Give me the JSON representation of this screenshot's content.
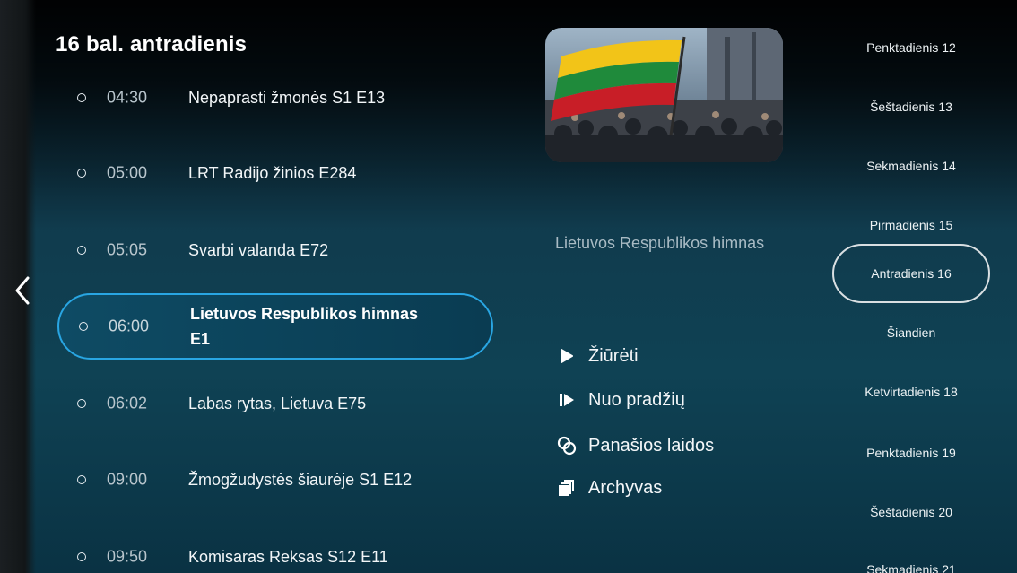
{
  "header": {
    "title": "16 bal. antradienis"
  },
  "programs": [
    {
      "time": "04:30",
      "title": "Nepaprasti žmonės S1 E13"
    },
    {
      "time": "05:00",
      "title": "LRT Radijo žinios E284"
    },
    {
      "time": "05:05",
      "title": "Svarbi valanda E72"
    },
    {
      "time": "06:00",
      "title": "Lietuvos Respublikos himnas E1",
      "selected": true
    },
    {
      "time": "06:02",
      "title": "Labas rytas, Lietuva E75"
    },
    {
      "time": "09:00",
      "title": "Žmogžudystės šiaurėje S1 E12"
    },
    {
      "time": "09:50",
      "title": "Komisaras Reksas S12 E11"
    }
  ],
  "details": {
    "description": "Lietuvos Respublikos himnas",
    "actions": [
      {
        "label": "Žiūrėti",
        "icon": "play-icon"
      },
      {
        "label": "Nuo pradžių",
        "icon": "restart-icon"
      },
      {
        "label": "Panašios laidos",
        "icon": "similar-icon"
      },
      {
        "label": "Archyvas",
        "icon": "archive-icon"
      }
    ]
  },
  "days": [
    "Penktadienis 12",
    "Šeštadienis 13",
    "Sekmadienis 14",
    "Pirmadienis 15",
    "Antradienis 16",
    "Šiandien",
    "Ketvirtadienis 18",
    "Penktadienis 19",
    "Šeštadienis 20",
    "Sekmadienis 21"
  ],
  "active_day_index": 4,
  "colors": {
    "accent": "#29a6e3",
    "background": "#0f4254"
  }
}
